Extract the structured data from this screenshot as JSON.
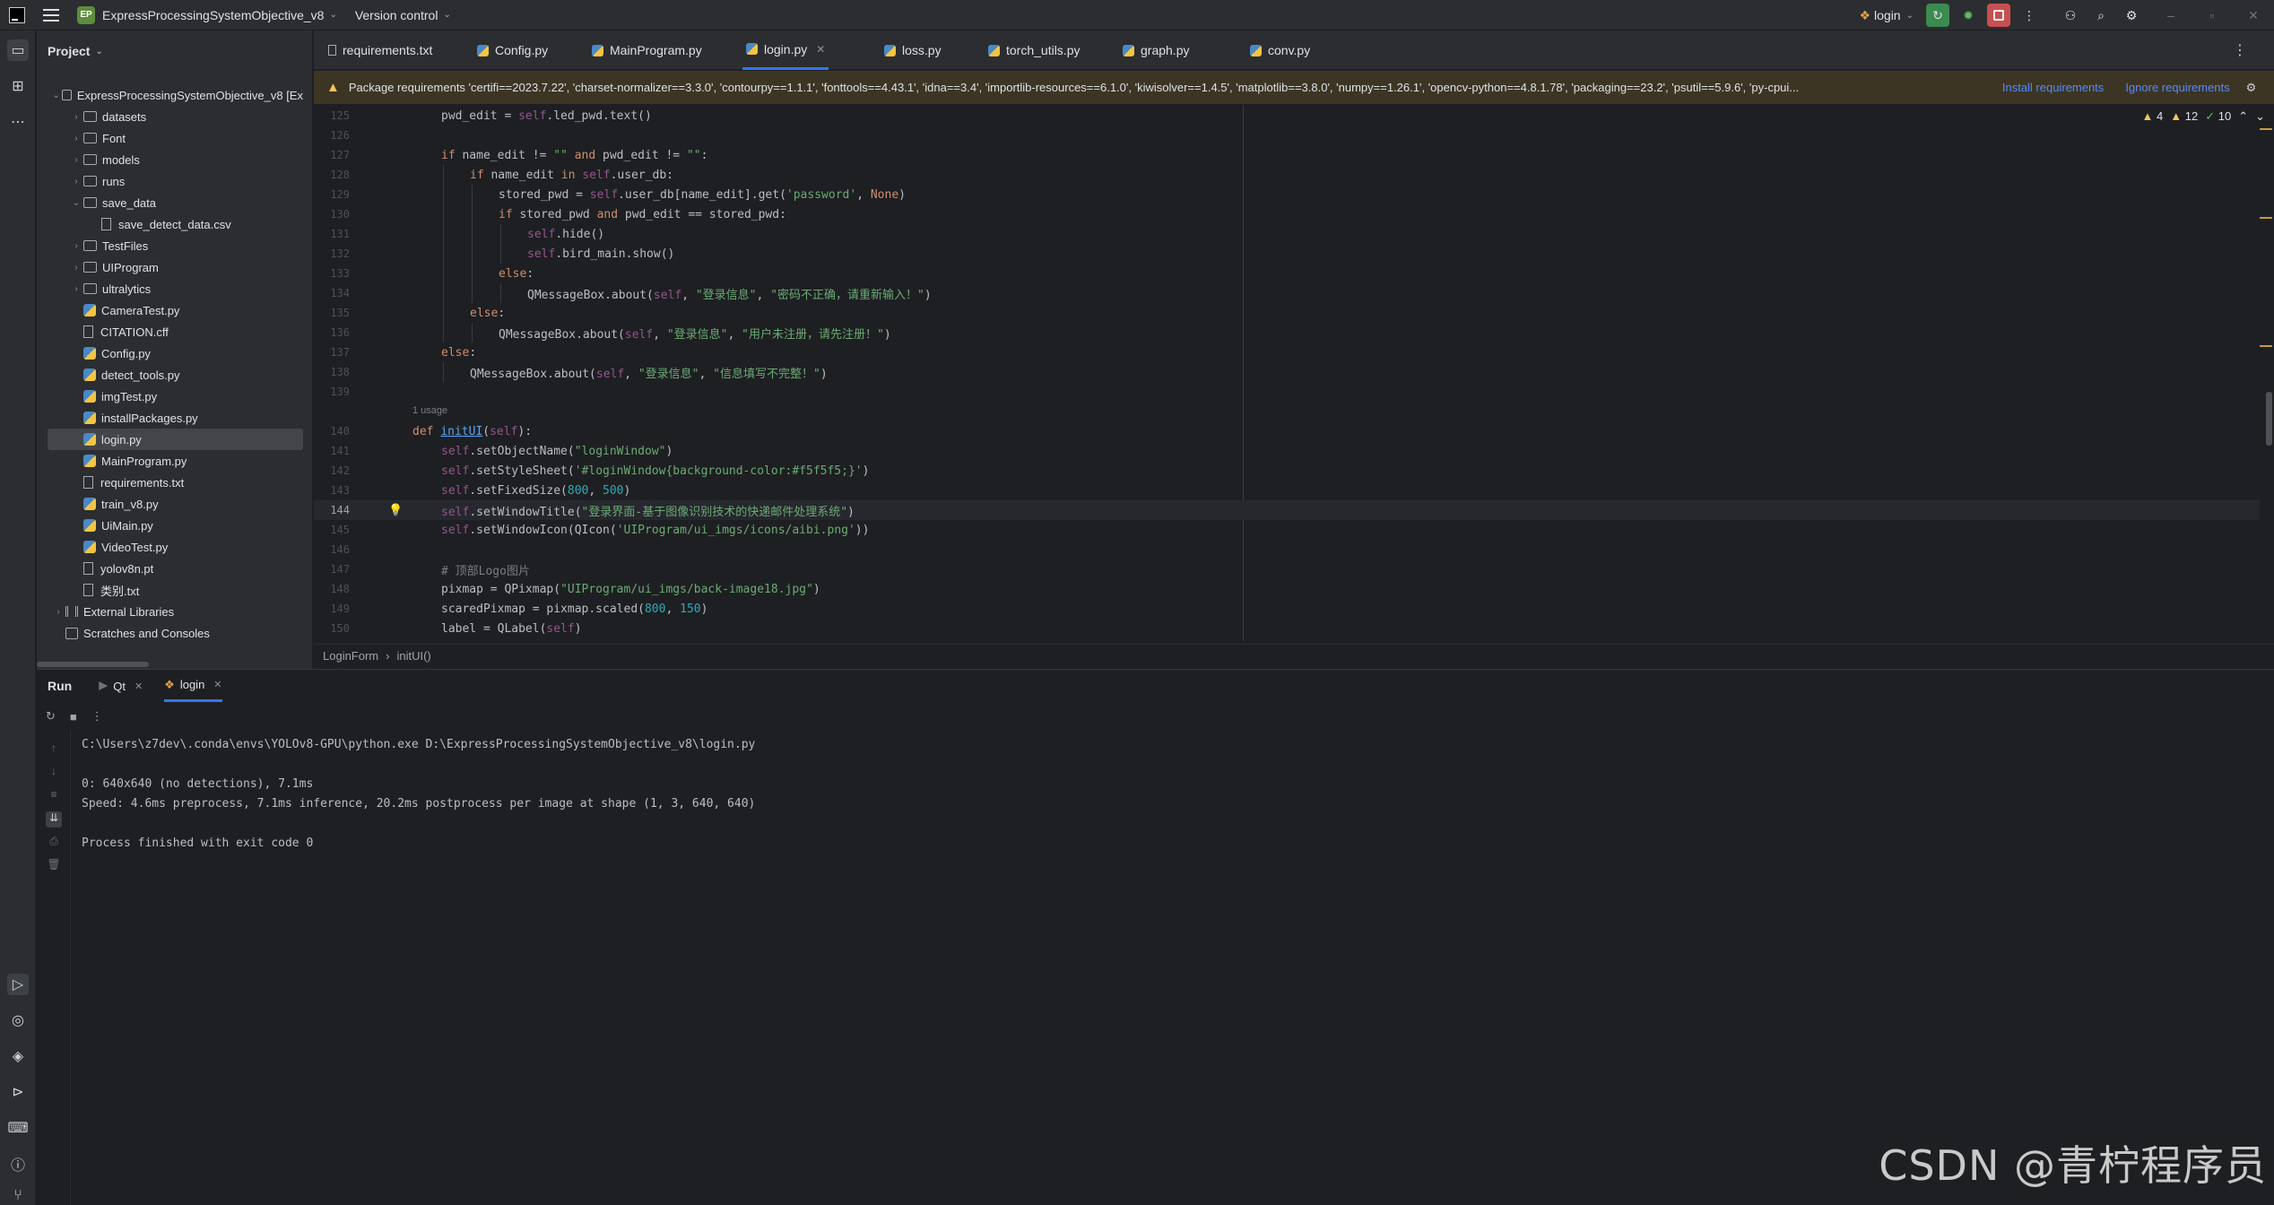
{
  "titlebar": {
    "badge": "EP",
    "project_name": "ExpressProcessingSystemObjective_v8",
    "version_control": "Version control",
    "run_config": "login"
  },
  "project_panel": {
    "title": "Project",
    "tree": [
      {
        "label": "ExpressProcessingSystemObjective_v8 [Ex",
        "type": "folder",
        "depth": 0,
        "expanded": true
      },
      {
        "label": "datasets",
        "type": "folder",
        "depth": 1
      },
      {
        "label": "Font",
        "type": "folder",
        "depth": 1
      },
      {
        "label": "models",
        "type": "folder",
        "depth": 1
      },
      {
        "label": "runs",
        "type": "folder",
        "depth": 1
      },
      {
        "label": "save_data",
        "type": "folder",
        "depth": 1,
        "expanded": true
      },
      {
        "label": "save_detect_data.csv",
        "type": "txt",
        "depth": 2
      },
      {
        "label": "TestFiles",
        "type": "folder",
        "depth": 1
      },
      {
        "label": "UIProgram",
        "type": "folder",
        "depth": 1
      },
      {
        "label": "ultralytics",
        "type": "folder",
        "depth": 1
      },
      {
        "label": "CameraTest.py",
        "type": "py",
        "depth": 1
      },
      {
        "label": "CITATION.cff",
        "type": "txt",
        "depth": 1
      },
      {
        "label": "Config.py",
        "type": "py",
        "depth": 1
      },
      {
        "label": "detect_tools.py",
        "type": "py",
        "depth": 1
      },
      {
        "label": "imgTest.py",
        "type": "py",
        "depth": 1
      },
      {
        "label": "installPackages.py",
        "type": "py",
        "depth": 1
      },
      {
        "label": "login.py",
        "type": "py",
        "depth": 1,
        "selected": true
      },
      {
        "label": "MainProgram.py",
        "type": "py",
        "depth": 1
      },
      {
        "label": "requirements.txt",
        "type": "txt",
        "depth": 1
      },
      {
        "label": "train_v8.py",
        "type": "py",
        "depth": 1
      },
      {
        "label": "UiMain.py",
        "type": "py",
        "depth": 1
      },
      {
        "label": "VideoTest.py",
        "type": "py",
        "depth": 1
      },
      {
        "label": "yolov8n.pt",
        "type": "txt",
        "depth": 1
      },
      {
        "label": "类别.txt",
        "type": "txt",
        "depth": 1
      },
      {
        "label": "External Libraries",
        "type": "lib",
        "depth": 0
      },
      {
        "label": "Scratches and Consoles",
        "type": "scratch",
        "depth": 0
      }
    ]
  },
  "tabs": [
    {
      "label": "requirements.txt",
      "icon": "txt"
    },
    {
      "label": "Config.py",
      "icon": "py"
    },
    {
      "label": "MainProgram.py",
      "icon": "py"
    },
    {
      "label": "login.py",
      "icon": "py",
      "active": true
    },
    {
      "label": "loss.py",
      "icon": "py"
    },
    {
      "label": "torch_utils.py",
      "icon": "py"
    },
    {
      "label": "graph.py",
      "icon": "py"
    },
    {
      "label": "conv.py",
      "icon": "py"
    }
  ],
  "banner": {
    "text": "Package requirements 'certifi==2023.7.22', 'charset-normalizer==3.3.0', 'contourpy==1.1.1', 'fonttools==4.43.1', 'idna==3.4', 'importlib-resources==6.1.0', 'kiwisolver==1.4.5', 'matplotlib==3.8.0', 'numpy==1.26.1', 'opencv-python==4.8.1.78', 'packaging==23.2', 'psutil==5.9.6', 'py-cpui...",
    "install": "Install requirements",
    "ignore": "Ignore requirements"
  },
  "inspections": {
    "warnings": "4",
    "weak": "12",
    "ok": "10"
  },
  "code": {
    "usage_hint": "1 usage",
    "lines": [
      {
        "n": "125",
        "i": 1,
        "t": [
          [
            "",
            "pwd_edit = "
          ],
          [
            "sf",
            "self"
          ],
          [
            "",
            ".led_pwd.text()"
          ]
        ]
      },
      {
        "n": "126",
        "i": 0,
        "t": []
      },
      {
        "n": "127",
        "i": 1,
        "t": [
          [
            "k",
            "if "
          ],
          [
            "",
            "name_edit != "
          ],
          [
            "s",
            "\"\""
          ],
          [
            "k",
            " and "
          ],
          [
            "",
            "pwd_edit != "
          ],
          [
            "s",
            "\"\""
          ],
          [
            "",
            ":"
          ]
        ]
      },
      {
        "n": "128",
        "i": 2,
        "t": [
          [
            "k",
            "if "
          ],
          [
            "",
            "name_edit "
          ],
          [
            "k",
            "in "
          ],
          [
            "sf",
            "self"
          ],
          [
            "",
            ".user_db:"
          ]
        ]
      },
      {
        "n": "129",
        "i": 3,
        "t": [
          [
            "",
            "stored_pwd = "
          ],
          [
            "sf",
            "self"
          ],
          [
            "",
            ".user_db[name_edit].get("
          ],
          [
            "s",
            "'password'"
          ],
          [
            "",
            ", "
          ],
          [
            "k",
            "None"
          ],
          [
            "",
            ")"
          ]
        ]
      },
      {
        "n": "130",
        "i": 3,
        "t": [
          [
            "k",
            "if "
          ],
          [
            "",
            "stored_pwd "
          ],
          [
            "k",
            "and "
          ],
          [
            "",
            "pwd_edit == stored_pwd:"
          ]
        ]
      },
      {
        "n": "131",
        "i": 4,
        "t": [
          [
            "sf",
            "self"
          ],
          [
            "",
            ".hide()"
          ]
        ]
      },
      {
        "n": "132",
        "i": 4,
        "t": [
          [
            "sf",
            "self"
          ],
          [
            "",
            ".bird_main.show()"
          ]
        ]
      },
      {
        "n": "133",
        "i": 3,
        "t": [
          [
            "k",
            "else"
          ],
          [
            "",
            ":"
          ]
        ]
      },
      {
        "n": "134",
        "i": 4,
        "t": [
          [
            "",
            "QMessageBox.about("
          ],
          [
            "sf",
            "self"
          ],
          [
            "",
            ", "
          ],
          [
            "s",
            "\"登录信息\""
          ],
          [
            "",
            ", "
          ],
          [
            "s",
            "\"密码不正确，请重新输入！\""
          ],
          [
            "",
            ")"
          ]
        ]
      },
      {
        "n": "135",
        "i": 2,
        "t": [
          [
            "k",
            "else"
          ],
          [
            "",
            ":"
          ]
        ]
      },
      {
        "n": "136",
        "i": 3,
        "t": [
          [
            "",
            "QMessageBox.about("
          ],
          [
            "sf",
            "self"
          ],
          [
            "",
            ", "
          ],
          [
            "s",
            "\"登录信息\""
          ],
          [
            "",
            ", "
          ],
          [
            "s",
            "\"用户未注册，请先注册！\""
          ],
          [
            "",
            ")"
          ]
        ]
      },
      {
        "n": "137",
        "i": 1,
        "t": [
          [
            "k",
            "else"
          ],
          [
            "",
            ":"
          ]
        ]
      },
      {
        "n": "138",
        "i": 2,
        "t": [
          [
            "",
            "QMessageBox.about("
          ],
          [
            "sf",
            "self"
          ],
          [
            "",
            ", "
          ],
          [
            "s",
            "\"登录信息\""
          ],
          [
            "",
            ", "
          ],
          [
            "s",
            "\"信息填写不完整！\""
          ],
          [
            "",
            ")"
          ]
        ]
      },
      {
        "n": "139",
        "i": 0,
        "t": []
      },
      {
        "n": "",
        "i": 0,
        "t": [],
        "usage": true
      },
      {
        "n": "140",
        "i": 0,
        "t": [
          [
            "k",
            "def "
          ],
          [
            "fn",
            "initUI"
          ],
          [
            "",
            "("
          ],
          [
            "sf",
            "self"
          ],
          [
            "",
            "):"
          ]
        ]
      },
      {
        "n": "141",
        "i": 1,
        "t": [
          [
            "sf",
            "self"
          ],
          [
            "",
            ".setObjectName("
          ],
          [
            "s",
            "\"loginWindow\""
          ],
          [
            "",
            ")"
          ]
        ]
      },
      {
        "n": "142",
        "i": 1,
        "t": [
          [
            "sf",
            "self"
          ],
          [
            "",
            ".setStyleSheet("
          ],
          [
            "s",
            "'#loginWindow{background-color:#f5f5f5;}'"
          ],
          [
            "",
            ")"
          ]
        ]
      },
      {
        "n": "143",
        "i": 1,
        "t": [
          [
            "sf",
            "self"
          ],
          [
            "",
            ".setFixedSize("
          ],
          [
            "n",
            "800"
          ],
          [
            "",
            ", "
          ],
          [
            "n",
            "500"
          ],
          [
            "",
            ")"
          ]
        ]
      },
      {
        "n": "144",
        "i": 1,
        "t": [
          [
            "sf",
            "self"
          ],
          [
            "",
            ".setWindowTitle("
          ],
          [
            "s",
            "\"登录界面-基于图像识别技术的快递邮件处理系统\""
          ],
          [
            "",
            ")"
          ]
        ],
        "current": true
      },
      {
        "n": "145",
        "i": 1,
        "t": [
          [
            "sf",
            "self"
          ],
          [
            "",
            ".setWindowIcon(QIcon("
          ],
          [
            "s",
            "'UIProgram/ui_imgs/icons/aibi.png'"
          ],
          [
            "",
            "))"
          ]
        ]
      },
      {
        "n": "146",
        "i": 0,
        "t": []
      },
      {
        "n": "147",
        "i": 1,
        "t": [
          [
            "c",
            "# 顶部Logo图片"
          ]
        ]
      },
      {
        "n": "148",
        "i": 1,
        "t": [
          [
            "",
            "pixmap = QPixmap("
          ],
          [
            "s",
            "\"UIProgram/ui_imgs/back-image18.jpg\""
          ],
          [
            "",
            ")"
          ]
        ]
      },
      {
        "n": "149",
        "i": 1,
        "t": [
          [
            "",
            "scaredPixmap = pixmap.scaled("
          ],
          [
            "n",
            "800"
          ],
          [
            "",
            ", "
          ],
          [
            "n",
            "150"
          ],
          [
            "",
            ")"
          ]
        ]
      },
      {
        "n": "150",
        "i": 1,
        "t": [
          [
            "",
            "label = QLabel("
          ],
          [
            "sf",
            "self"
          ],
          [
            "",
            ")"
          ]
        ]
      }
    ]
  },
  "breadcrumbs": [
    "LoginForm",
    "initUI()"
  ],
  "run_panel": {
    "title": "Run",
    "tabs": [
      "Qt",
      "login"
    ],
    "console": [
      "C:\\Users\\z7dev\\.conda\\envs\\YOLOv8-GPU\\python.exe D:\\ExpressProcessingSystemObjective_v8\\login.py",
      "",
      "0: 640x640 (no detections), 7.1ms",
      "Speed: 4.6ms preprocess, 7.1ms inference, 20.2ms postprocess per image at shape (1, 3, 640, 640)",
      "",
      "Process finished with exit code 0"
    ]
  },
  "watermark": "CSDN @青柠程序员"
}
